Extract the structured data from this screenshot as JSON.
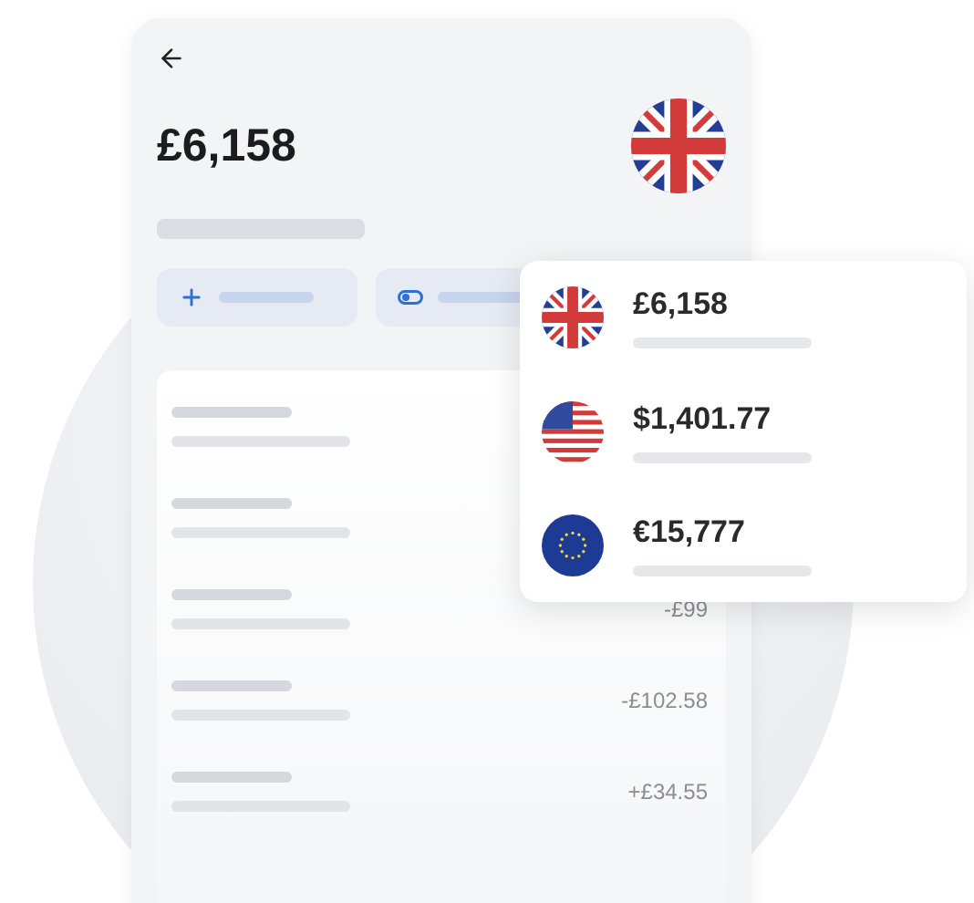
{
  "header": {
    "balance": "£6,158",
    "kind": "uk"
  },
  "actions": [
    {
      "kind": "add"
    },
    {
      "kind": "toggle"
    }
  ],
  "transactions": [
    {
      "kind": "blank"
    },
    {
      "kind": "blank"
    },
    {
      "kind": "amount",
      "amount": "-£99"
    },
    {
      "kind": "amount",
      "amount": "-£102.58"
    },
    {
      "kind": "amount",
      "amount": "+£34.55"
    }
  ],
  "currency_menu": [
    {
      "kind": "uk",
      "amount": "£6,158"
    },
    {
      "kind": "us",
      "amount": "$1,401.77"
    },
    {
      "kind": "eu",
      "amount": "€15,777"
    }
  ]
}
